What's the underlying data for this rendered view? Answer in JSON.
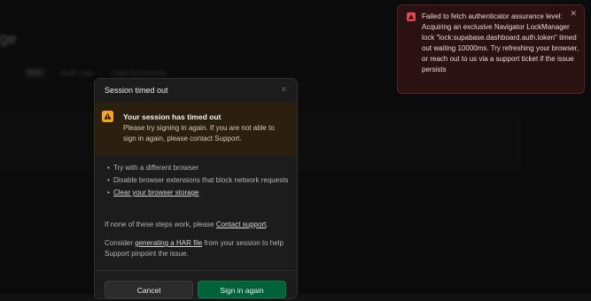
{
  "background": {
    "title": "rge",
    "tabs": [
      "...",
      "SSO",
      "Audit Logs",
      "Legal Documents"
    ]
  },
  "toast": {
    "message": "Failed to fetch authenticator assurance level: Acquiring an exclusive Navigator LockManager lock \"lock:supabase.dashboard.auth.token\" timed out waiting 10000ms. Try refreshing your browser, or reach out to us via a support ticket if the issue persists",
    "close": "✕",
    "color": "#2a1212"
  },
  "modal": {
    "title": "Session timed out",
    "close": "✕",
    "warning": {
      "title": "Your session has timed out",
      "body": "Please try signing in again. If you are not able to sign in again, please contact Support."
    },
    "tips": [
      "Try with a different browser",
      "Disable browser extensions that block network requests",
      "Clear your browser storage"
    ],
    "help_prefix": "If none of these steps work, please ",
    "help_link": "Contact support",
    "help_suffix": ".",
    "har_prefix": "Consider ",
    "har_link": "generating a HAR file",
    "har_suffix": " from your session to help Support pinpoint the issue.",
    "cancel_label": "Cancel",
    "signin_label": "Sign in again"
  },
  "colors": {
    "accent": "#006239",
    "warning": "#f5a623",
    "error": "#e5484d"
  }
}
